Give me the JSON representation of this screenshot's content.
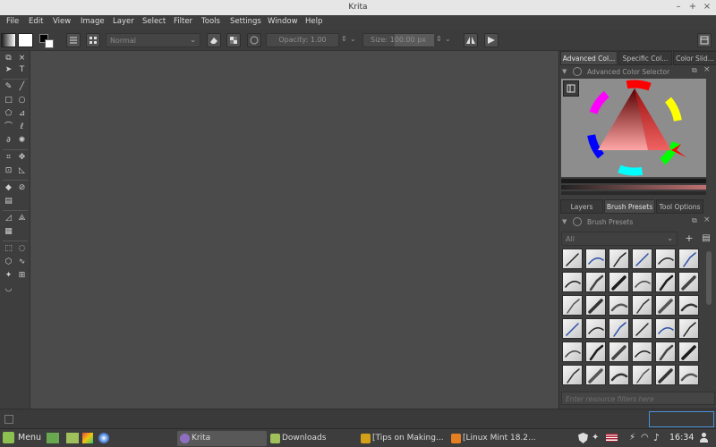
{
  "window": {
    "title": "Krita",
    "min": "–",
    "max": "+",
    "close": "×"
  },
  "menu": [
    "File",
    "Edit",
    "View",
    "Image",
    "Layer",
    "Select",
    "Filter",
    "Tools",
    "Settings",
    "Window",
    "Help"
  ],
  "toolbar": {
    "blend_mode": "Normal",
    "opacity_label": "Opacity:",
    "opacity_value": "1.00",
    "size_label": "Size:",
    "size_value": "100.00 px"
  },
  "dock_top_tabs": [
    "Advanced Col...",
    "Specific Col...",
    "Color Slid..."
  ],
  "advanced_color_selector_title": "Advanced Color Selector",
  "dock_bottom_tabs": [
    "Layers",
    "Brush Presets",
    "Tool Options"
  ],
  "brush_presets": {
    "title": "Brush Presets",
    "tag_filter": "All",
    "filter_placeholder": "Enter resource filters here"
  },
  "taskbar": {
    "menu_label": "Menu",
    "tasks": [
      "Krita",
      "Downloads",
      "[Tips on Making...",
      "[Linux Mint 18.2..."
    ],
    "clock": "16:34"
  },
  "colors": {
    "accent": "#4a90d9",
    "krita_red": "#ff0000"
  }
}
